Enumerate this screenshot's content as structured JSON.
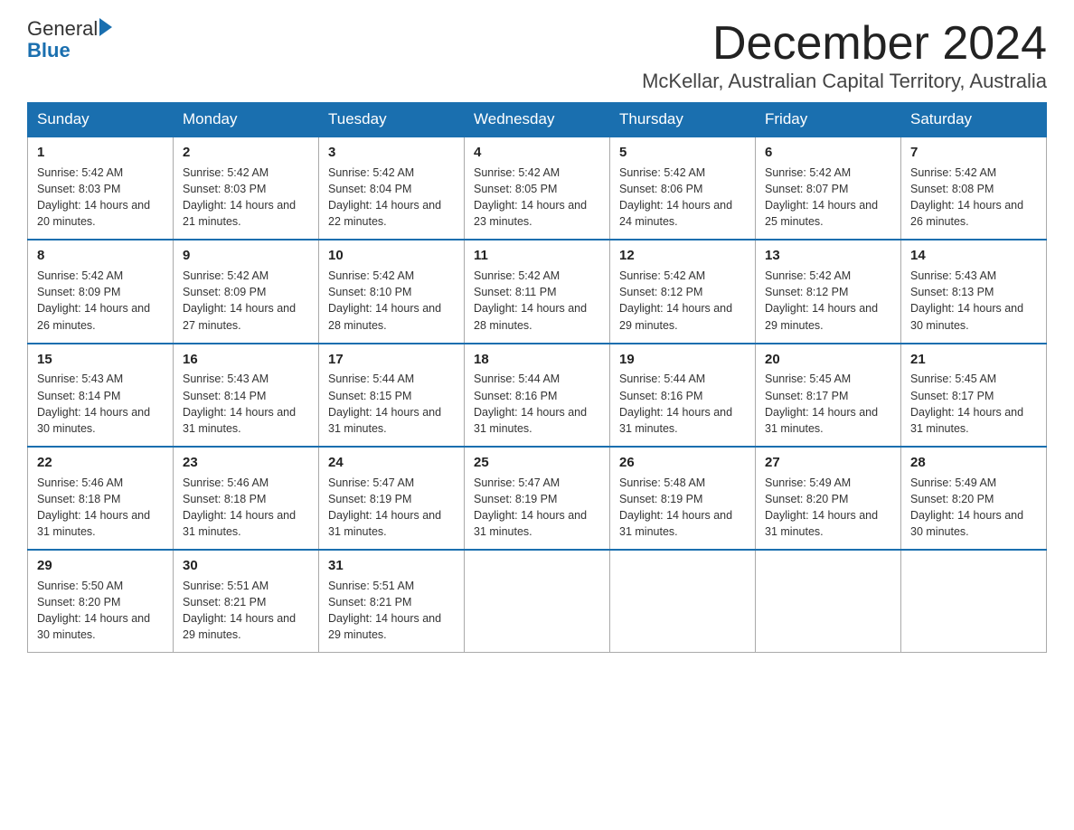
{
  "header": {
    "logo_text_general": "General",
    "logo_text_blue": "Blue",
    "month_title": "December 2024",
    "location": "McKellar, Australian Capital Territory, Australia"
  },
  "days_of_week": [
    "Sunday",
    "Monday",
    "Tuesday",
    "Wednesday",
    "Thursday",
    "Friday",
    "Saturday"
  ],
  "weeks": [
    [
      {
        "day": "1",
        "sunrise": "5:42 AM",
        "sunset": "8:03 PM",
        "daylight": "14 hours and 20 minutes."
      },
      {
        "day": "2",
        "sunrise": "5:42 AM",
        "sunset": "8:03 PM",
        "daylight": "14 hours and 21 minutes."
      },
      {
        "day": "3",
        "sunrise": "5:42 AM",
        "sunset": "8:04 PM",
        "daylight": "14 hours and 22 minutes."
      },
      {
        "day": "4",
        "sunrise": "5:42 AM",
        "sunset": "8:05 PM",
        "daylight": "14 hours and 23 minutes."
      },
      {
        "day": "5",
        "sunrise": "5:42 AM",
        "sunset": "8:06 PM",
        "daylight": "14 hours and 24 minutes."
      },
      {
        "day": "6",
        "sunrise": "5:42 AM",
        "sunset": "8:07 PM",
        "daylight": "14 hours and 25 minutes."
      },
      {
        "day": "7",
        "sunrise": "5:42 AM",
        "sunset": "8:08 PM",
        "daylight": "14 hours and 26 minutes."
      }
    ],
    [
      {
        "day": "8",
        "sunrise": "5:42 AM",
        "sunset": "8:09 PM",
        "daylight": "14 hours and 26 minutes."
      },
      {
        "day": "9",
        "sunrise": "5:42 AM",
        "sunset": "8:09 PM",
        "daylight": "14 hours and 27 minutes."
      },
      {
        "day": "10",
        "sunrise": "5:42 AM",
        "sunset": "8:10 PM",
        "daylight": "14 hours and 28 minutes."
      },
      {
        "day": "11",
        "sunrise": "5:42 AM",
        "sunset": "8:11 PM",
        "daylight": "14 hours and 28 minutes."
      },
      {
        "day": "12",
        "sunrise": "5:42 AM",
        "sunset": "8:12 PM",
        "daylight": "14 hours and 29 minutes."
      },
      {
        "day": "13",
        "sunrise": "5:42 AM",
        "sunset": "8:12 PM",
        "daylight": "14 hours and 29 minutes."
      },
      {
        "day": "14",
        "sunrise": "5:43 AM",
        "sunset": "8:13 PM",
        "daylight": "14 hours and 30 minutes."
      }
    ],
    [
      {
        "day": "15",
        "sunrise": "5:43 AM",
        "sunset": "8:14 PM",
        "daylight": "14 hours and 30 minutes."
      },
      {
        "day": "16",
        "sunrise": "5:43 AM",
        "sunset": "8:14 PM",
        "daylight": "14 hours and 31 minutes."
      },
      {
        "day": "17",
        "sunrise": "5:44 AM",
        "sunset": "8:15 PM",
        "daylight": "14 hours and 31 minutes."
      },
      {
        "day": "18",
        "sunrise": "5:44 AM",
        "sunset": "8:16 PM",
        "daylight": "14 hours and 31 minutes."
      },
      {
        "day": "19",
        "sunrise": "5:44 AM",
        "sunset": "8:16 PM",
        "daylight": "14 hours and 31 minutes."
      },
      {
        "day": "20",
        "sunrise": "5:45 AM",
        "sunset": "8:17 PM",
        "daylight": "14 hours and 31 minutes."
      },
      {
        "day": "21",
        "sunrise": "5:45 AM",
        "sunset": "8:17 PM",
        "daylight": "14 hours and 31 minutes."
      }
    ],
    [
      {
        "day": "22",
        "sunrise": "5:46 AM",
        "sunset": "8:18 PM",
        "daylight": "14 hours and 31 minutes."
      },
      {
        "day": "23",
        "sunrise": "5:46 AM",
        "sunset": "8:18 PM",
        "daylight": "14 hours and 31 minutes."
      },
      {
        "day": "24",
        "sunrise": "5:47 AM",
        "sunset": "8:19 PM",
        "daylight": "14 hours and 31 minutes."
      },
      {
        "day": "25",
        "sunrise": "5:47 AM",
        "sunset": "8:19 PM",
        "daylight": "14 hours and 31 minutes."
      },
      {
        "day": "26",
        "sunrise": "5:48 AM",
        "sunset": "8:19 PM",
        "daylight": "14 hours and 31 minutes."
      },
      {
        "day": "27",
        "sunrise": "5:49 AM",
        "sunset": "8:20 PM",
        "daylight": "14 hours and 31 minutes."
      },
      {
        "day": "28",
        "sunrise": "5:49 AM",
        "sunset": "8:20 PM",
        "daylight": "14 hours and 30 minutes."
      }
    ],
    [
      {
        "day": "29",
        "sunrise": "5:50 AM",
        "sunset": "8:20 PM",
        "daylight": "14 hours and 30 minutes."
      },
      {
        "day": "30",
        "sunrise": "5:51 AM",
        "sunset": "8:21 PM",
        "daylight": "14 hours and 29 minutes."
      },
      {
        "day": "31",
        "sunrise": "5:51 AM",
        "sunset": "8:21 PM",
        "daylight": "14 hours and 29 minutes."
      },
      null,
      null,
      null,
      null
    ]
  ]
}
